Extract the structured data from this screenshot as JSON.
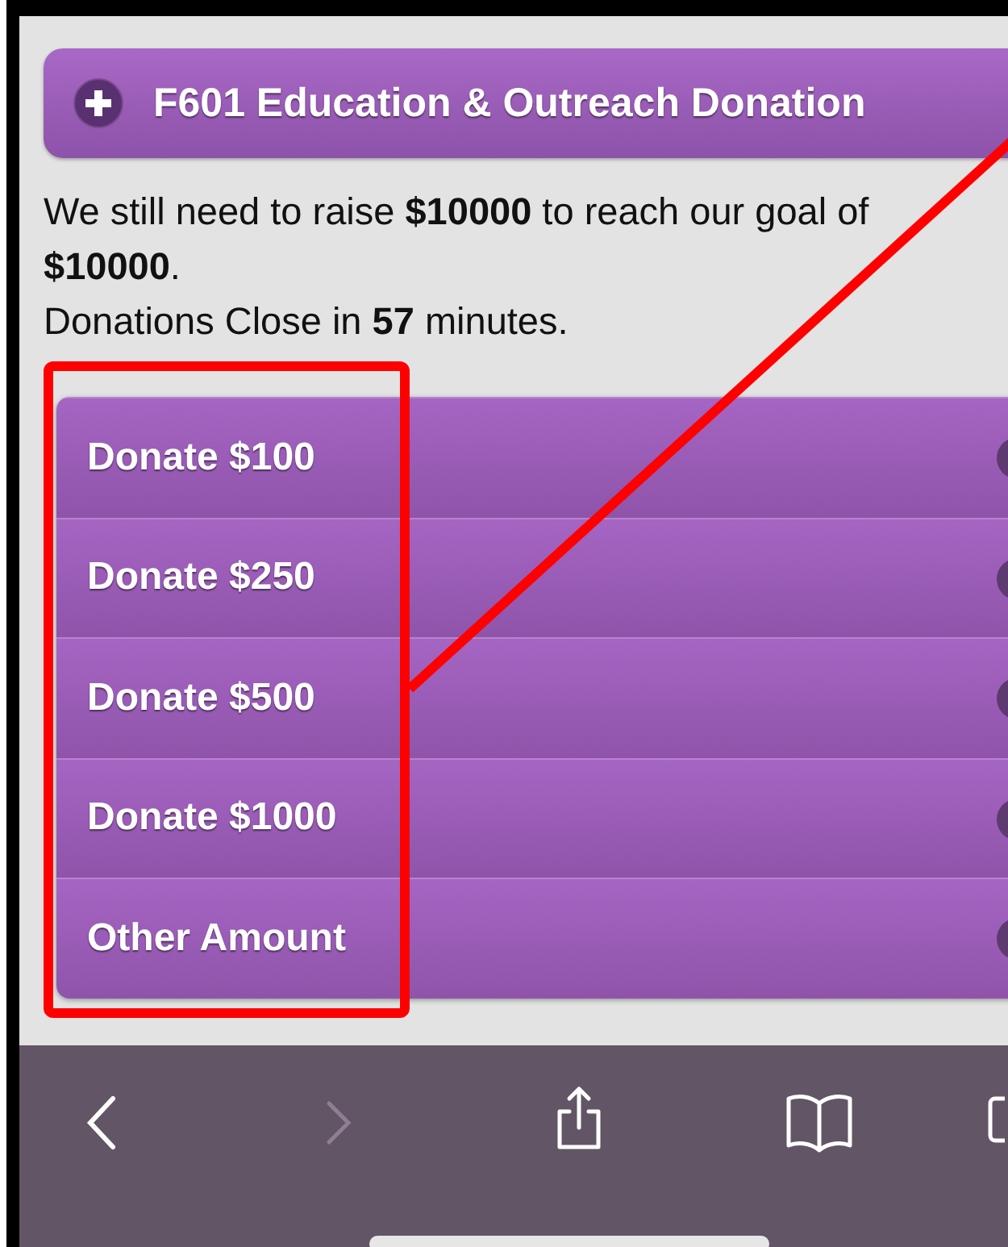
{
  "header": {
    "title": "F601 Education & Outreach Donation"
  },
  "message": [
    "We still need to raise **$10000** to reach our goal of **$10000**.",
    "Donations Close in **57** minutes."
  ],
  "options": [
    {
      "label": "Donate $100"
    },
    {
      "label": "Donate $250"
    },
    {
      "label": "Donate $500"
    },
    {
      "label": "Donate $1000"
    },
    {
      "label": "Other Amount"
    }
  ],
  "toolbar": [
    {
      "kind": "back",
      "disabled": false
    },
    {
      "kind": "forward",
      "disabled": true
    },
    {
      "kind": "share",
      "disabled": false
    },
    {
      "kind": "bookmarks",
      "disabled": false
    },
    {
      "kind": "tabs",
      "disabled": false
    }
  ],
  "highlight_box": {
    "color": "#ff0000"
  },
  "pointer_line": {
    "color": "#ff0000"
  }
}
